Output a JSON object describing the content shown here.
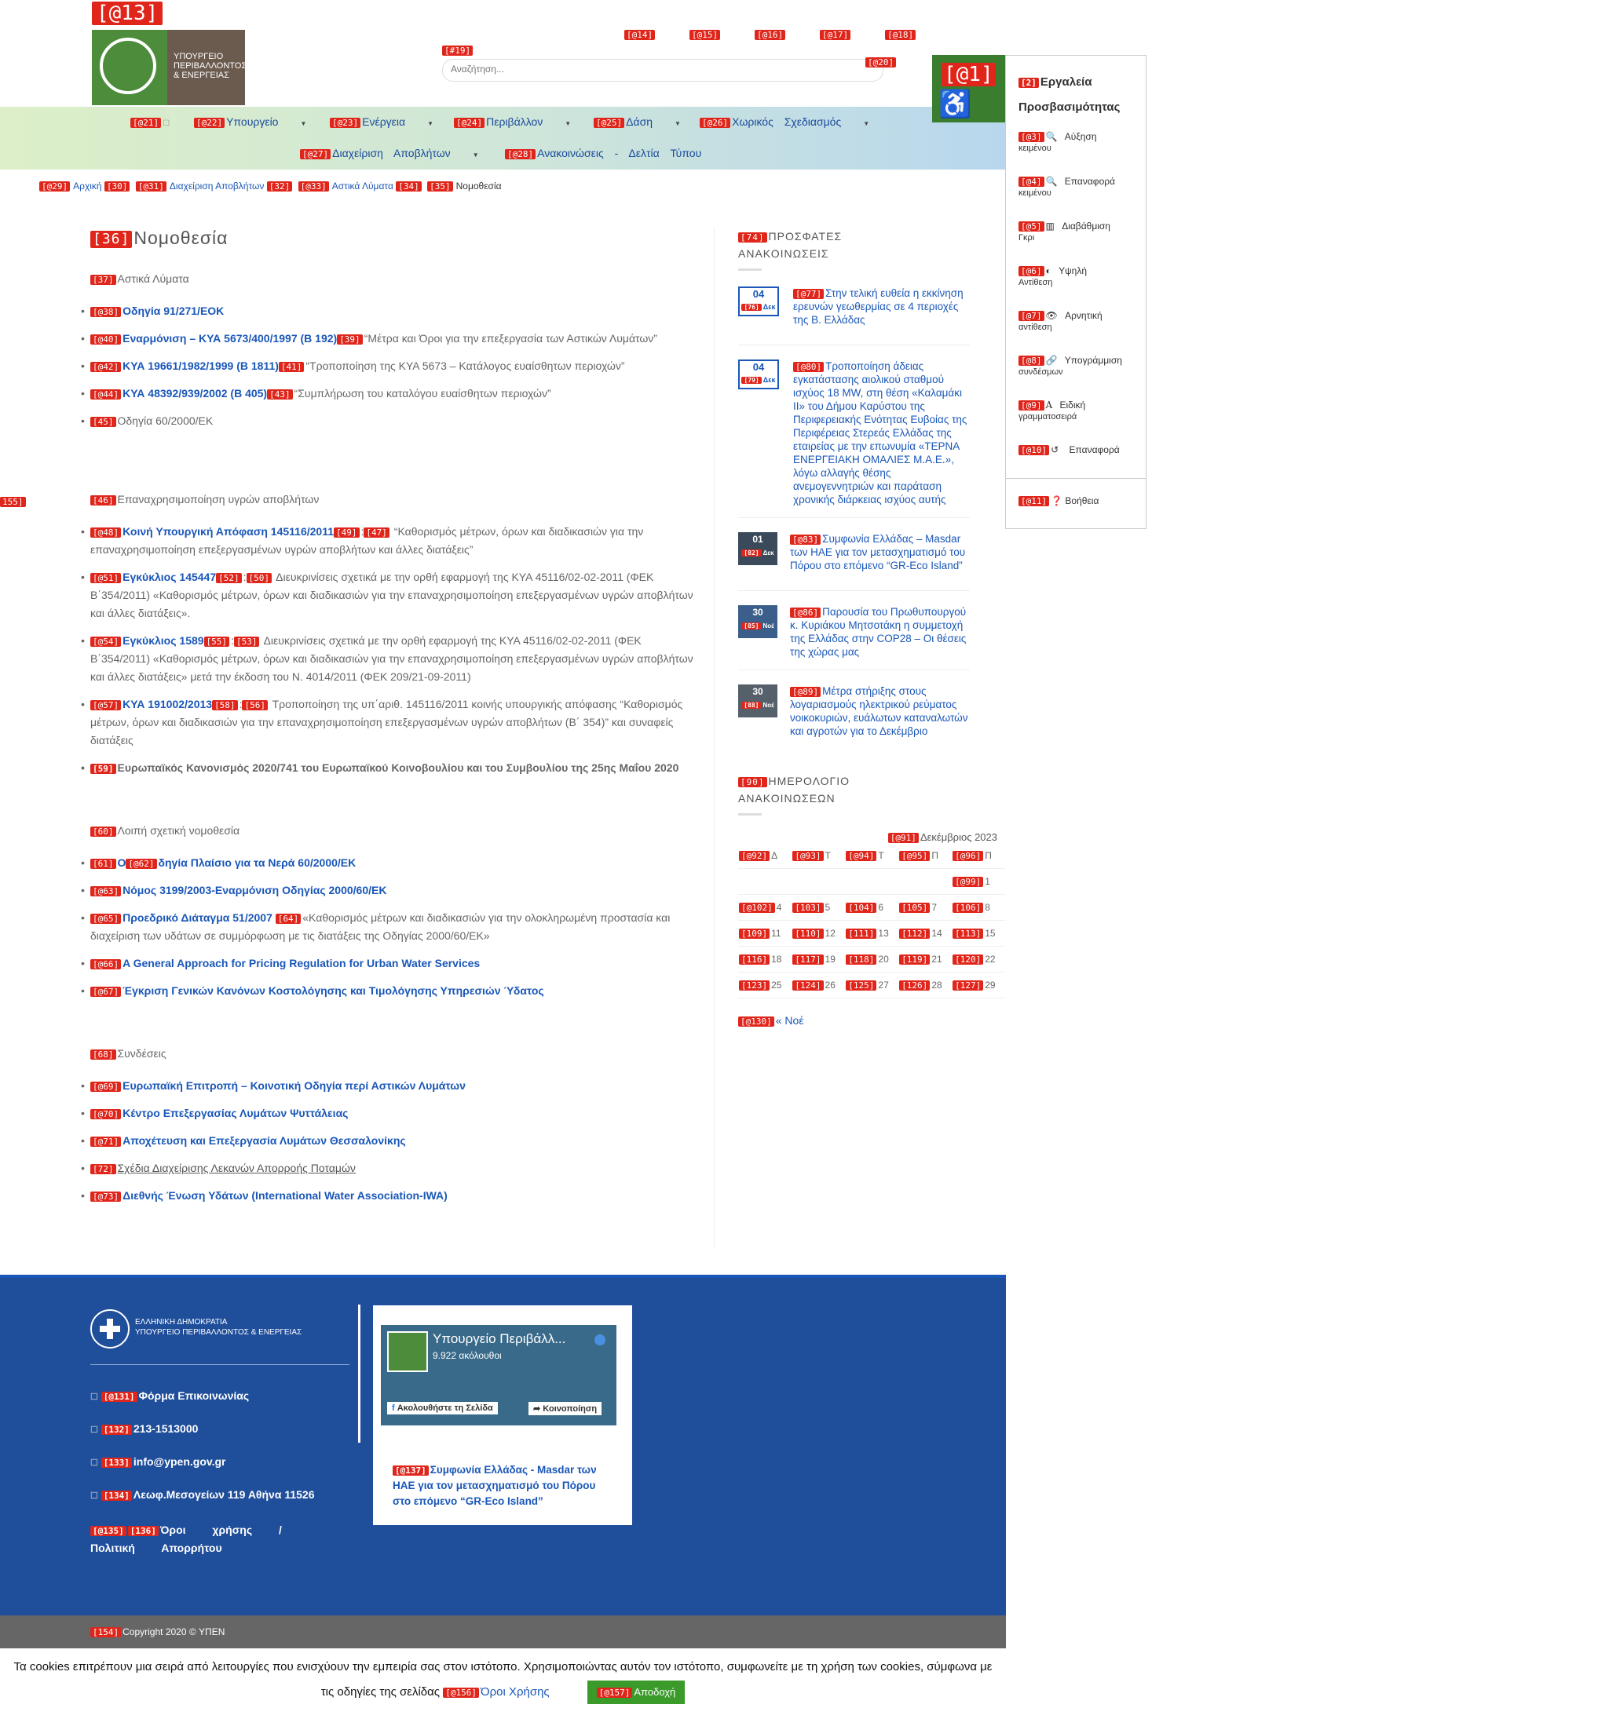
{
  "header": {
    "logo_tag": "[@13]",
    "logo_text_1": "ΥΠΟΥΡΓΕΙΟ",
    "logo_text_2": "ΠΕΡΙΒΑΛΛΟΝΤΟΣ",
    "logo_text_3": "& ΕΝΕΡΓΕΙΑΣ",
    "toplinks": [
      "[@14]",
      "[@15]",
      "[@16]",
      "[@17]",
      "[@18]"
    ],
    "search_tag": "[#19]",
    "search_placeholder": "Αναζήτηση...",
    "search_btn_tag": "[@20]"
  },
  "nav": [
    {
      "tag": "[@21]",
      "label": ""
    },
    {
      "tag": "[@22]",
      "label": "Υπουργείο"
    },
    {
      "tag": "[@23]",
      "label": "Ενέργεια"
    },
    {
      "tag": "[@24]",
      "label": "Περιβάλλον"
    },
    {
      "tag": "[@25]",
      "label": "Δάση"
    },
    {
      "tag": "[@26]",
      "label": "Χωρικός Σχεδιασμός"
    },
    {
      "tag": "[@27]",
      "label": "Διαχείριση Αποβλήτων"
    },
    {
      "tag": "[@28]",
      "label": "Ανακοινώσεις - Δελτία Τύπου"
    }
  ],
  "breadcrumb": {
    "t29": "[@29]",
    "home": "Αρχική",
    "t30": "[30]",
    "t31": "[@31]",
    "waste": "Διαχείριση Αποβλήτων",
    "t32": "[32]",
    "t33": "[@33]",
    "urban": "Αστικά Λύματα",
    "t34": "[34]",
    "t35": "[35]",
    "current": "Νομοθεσία"
  },
  "main": {
    "title_tag": "[36]",
    "title": "Νομοθεσία",
    "s1": {
      "tag": "[37]",
      "label": "Αστικά Λύματα"
    },
    "s1_items": [
      {
        "tag": "[@38]",
        "link": "Οδηγία 91/271/ΕΟΚ",
        "tag2": "",
        "text": ""
      },
      {
        "tag": "[@40]",
        "link": "Εναρμόνιση – ΚΥΑ 5673/400/1997 (Β 192)",
        "tag2": "[39]",
        "text": "“Μέτρα και Όροι για την επεξεργασία των Αστικών Λυμάτων”"
      },
      {
        "tag": "[@42]",
        "link": "ΚΥΑ 19661/1982/1999 (Β 1811)",
        "tag2": "[41]",
        "text": "“Τροποποίηση της ΚΥΑ 5673 – Κατάλογος ευαίσθητων περιοχών”"
      },
      {
        "tag": "[@44]",
        "link": "ΚΥΑ 48392/939/2002 (Β 405)",
        "tag2": "[43]",
        "text": "“Συμπλήρωση του καταλόγου ευαίσθητων περιοχών”"
      },
      {
        "tag": "[45]",
        "link": "",
        "tag2": "",
        "text": "Οδηγία 60/2000/ΕΚ"
      }
    ],
    "s2": {
      "tag": "[46]",
      "label": "Επαναχρησιμοποίηση υγρών αποβλήτων"
    },
    "s2_items": [
      {
        "tag": "[@48]",
        "link": "Κοινή Υπουργική Απόφαση 145116/2011",
        "tag2": "[49]",
        "tag3": "[47]",
        "text": "“Καθορισμός μέτρων, όρων και διαδικασιών για την επαναχρησιμοποίηση επεξεργασμένων υγρών αποβλήτων και άλλες διατάξεις”"
      },
      {
        "tag": "[@51]",
        "link": "Εγκύκλιος 145447",
        "tag2": "[52]",
        "tag3": "[50]",
        "text": "Διευκρινίσεις σχετικά με την ορθή εφαρμογή της ΚΥΑ 45116/02-02-2011 (ΦΕΚ Β΄354/2011) «Καθορισμός μέτρων, όρων και διαδικασιών για την επαναχρησιμοποίηση επεξεργασμένων υγρών αποβλήτων και άλλες διατάξεις»."
      },
      {
        "tag": "[@54]",
        "link": "Εγκύκλιος 1589",
        "tag2": "[55]",
        "tag3": "[53]",
        "text": "Διευκρινίσεις σχετικά με την ορθή εφαρμογή της ΚΥΑ 45116/02-02-2011 (ΦΕΚ Β΄354/2011) «Καθορισμός μέτρων, όρων και διαδικασιών για την επαναχρησιμοποίηση επεξεργασμένων υγρών αποβλήτων και άλλες διατάξεις» μετά την έκδοση του Ν. 4014/2011 (ΦΕΚ 209/21-09-2011)"
      },
      {
        "tag": "[@57]",
        "link": "ΚΥΑ 191002/2013",
        "tag2": "[58]",
        "tag3": "[56]",
        "text": "Τροποποίηση της υπ΄αριθ. 145116/2011 κοινής υπουργικής απόφασης “Καθορισμός μέτρων, όρων και διαδικασιών για την επαναχρησιμοποίηση επεξεργασμένων υγρών αποβλήτων (Β΄ 354)” και συναφείς διατάξεις"
      },
      {
        "tag": "[59]",
        "link": "",
        "tag2": "",
        "tag3": "",
        "text": "Ευρωπαϊκός Κανονισμός 2020/741 του Ευρωπαϊκού Κοινοβουλίου και του Συμβουλίου της 25ης Μαΐου 2020"
      }
    ],
    "s3": {
      "tag": "[60]",
      "label": "Λοιπή σχετική νομοθεσία"
    },
    "s3_items": [
      {
        "tag": "[61]",
        "link": "Ο",
        "tag2": "[@62]",
        "link2": "δηγία Πλαίσιο για τα Νερά 60/2000/ΕΚ",
        "text": ""
      },
      {
        "tag": "[@63]",
        "link": "Νόμος 3199/2003-Εναρμόνιση Οδηγίας 2000/60/ΕΚ",
        "tag2": "",
        "link2": "",
        "text": ""
      },
      {
        "tag": "[@65]",
        "link": "Προεδρικό Διάταγμα 51/2007",
        "tag2": "[64]",
        "link2": "",
        "text": "«Καθορισμός μέτρων και διαδικασιών για την ολοκληρωμένη προστασία και διαχείριση των υδάτων σε συμμόρφωση με τις διατάξεις της Οδηγίας 2000/60/ΕΚ»"
      },
      {
        "tag": "[@66]",
        "link": "A General Approach for Pricing Regulation for Urban Water Services",
        "tag2": "",
        "link2": "",
        "text": ""
      },
      {
        "tag": "[@67]",
        "link": "Έγκριση Γενικών Κανόνων Κοστολόγησης και Τιμολόγησης Υπηρεσιών Ύδατος",
        "tag2": "",
        "link2": "",
        "text": ""
      }
    ],
    "s4": {
      "tag": "[68]",
      "label": "Συνδέσεις"
    },
    "s4_items": [
      {
        "tag": "[@69]",
        "link": "Ευρωπαϊκή Επιτροπή – Κοινοτική Οδηγία περί Αστικών Λυμάτων"
      },
      {
        "tag": "[@70]",
        "link": "Κέντρο Επεξεργασίας Λυμάτων Ψυττάλειας"
      },
      {
        "tag": "[@71]",
        "link": "Αποχέτευση και Επεξεργασία Λυμάτων Θεσσαλονίκης"
      },
      {
        "tag": "[72]",
        "link": "Σχέδια Διαχείρισης Λεκανών Απορροής Ποταμών"
      },
      {
        "tag": "[@73]",
        "link": "Διεθνής Ένωση Υδάτων (International Water Association-IWA)"
      }
    ],
    "left_edge_tag": "155]"
  },
  "sidebar": {
    "recent_tag": "[74]",
    "recent_title_1": "ΠΡΟΣΦΑΤΕΣ",
    "recent_title_2": "ΑΝΑΚΟΙΝΩΣΕΙΣ",
    "news": [
      {
        "day": "04",
        "dtag": "[76]",
        "mon": "Δεκ",
        "tag": "[@77]",
        "text": "Στην τελική ευθεία η εκκίνηση ερευνών γεωθερμίας σε 4 περιοχές της Β. Ελλάδας",
        "thumb": false
      },
      {
        "day": "04",
        "dtag": "[79]",
        "mon": "Δεκ",
        "tag": "[@80]",
        "text": "Τροποποίηση άδειας εγκατάστασης αιολικού σταθμού ισχύος 18 MW, στη θέση «Καλαμάκι ΙΙ» του Δήμου Καρύστου της Περιφερειακής Ενότητας Ευβοίας της Περιφέρειας Στερεάς Ελλάδας της εταιρείας με την επωνυμία «ΤΕΡΝΑ ΕΝΕΡΓΕΙΑΚΗ ΟΜΑΛΙΕΣ Μ.Α.Ε.», λόγω αλλαγής θέσης ανεμογεννητριών και παράταση χρονικής διάρκειας ισχύος αυτής",
        "thumb": false
      },
      {
        "day": "01",
        "dtag": "[82]",
        "mon": "Δεκ",
        "tag": "[@83]",
        "text": "Συμφωνία Ελλάδας – Masdar των ΗΑΕ για τον μετασχηματισμό του Πόρου στο επόμενο “GR-Eco Island”",
        "thumb": true
      },
      {
        "day": "30",
        "dtag": "[85]",
        "mon": "Νοέ",
        "tag": "[@86]",
        "text": "Παρουσία του Πρωθυπουργού κ. Κυριάκου Μητσοτάκη η συμμετοχή της Ελλάδας στην COP28 – Οι θέσεις της χώρας μας",
        "thumb": true
      },
      {
        "day": "30",
        "dtag": "[88]",
        "mon": "Νοέ",
        "tag": "[@89]",
        "text": "Μέτρα στήριξης στους λογαριασμούς ηλεκτρικού ρεύματος νοικοκυριών, ευάλωτων καταναλωτών και αγροτών για το Δεκέμβριο",
        "thumb": true
      }
    ],
    "cal_tag": "[90]",
    "cal_title_1": "ΗΜΕΡΟΛΟΓΙΟ",
    "cal_title_2": "ΑΝΑΚΟΙΝΩΣΕΩΝ",
    "cal_month_tag": "[@91]",
    "cal_month": "Δεκέμβριος 2023",
    "cal_head": [
      [
        "[@92]",
        "Δ"
      ],
      [
        "[@93]",
        "Τ"
      ],
      [
        "[@94]",
        "Τ"
      ],
      [
        "[@95]",
        "Π"
      ],
      [
        "[@96]",
        "Π"
      ]
    ],
    "cal_rows": [
      [
        [
          "",
          ""
        ],
        [
          "",
          ""
        ],
        [
          "",
          ""
        ],
        [
          "",
          ""
        ],
        [
          "[@99]",
          "1"
        ]
      ],
      [
        [
          "[@102]",
          "4"
        ],
        [
          "[103]",
          "5"
        ],
        [
          "[104]",
          "6"
        ],
        [
          "[105]",
          "7"
        ],
        [
          "[106]",
          "8"
        ]
      ],
      [
        [
          "[109]",
          "11"
        ],
        [
          "[110]",
          "12"
        ],
        [
          "[111]",
          "13"
        ],
        [
          "[112]",
          "14"
        ],
        [
          "[113]",
          "15"
        ]
      ],
      [
        [
          "[116]",
          "18"
        ],
        [
          "[117]",
          "19"
        ],
        [
          "[118]",
          "20"
        ],
        [
          "[119]",
          "21"
        ],
        [
          "[120]",
          "22"
        ]
      ],
      [
        [
          "[123]",
          "25"
        ],
        [
          "[124]",
          "26"
        ],
        [
          "[125]",
          "27"
        ],
        [
          "[126]",
          "28"
        ],
        [
          "[127]",
          "29"
        ]
      ]
    ],
    "prev_tag": "[@130]",
    "prev_label": "« Νοέ"
  },
  "accessibility": {
    "btn_tag": "[@1]",
    "title_tag": "[2]",
    "title_1": "Εργαλεία",
    "title_2": "Προσβασιμότητας",
    "items": [
      {
        "tag": "[@3]",
        "icon": "🔍",
        "l1": "Αύξηση",
        "l2": "κειμένου"
      },
      {
        "tag": "[@4]",
        "icon": "🔍",
        "l1": "Επαναφορά",
        "l2": "κειμένου"
      },
      {
        "tag": "[@5]",
        "icon": "▥",
        "l1": "Διαβάθμιση",
        "l2": "Γκρι"
      },
      {
        "tag": "[@6]",
        "icon": "◐",
        "l1": "Υψηλή",
        "l2": "Αντίθεση"
      },
      {
        "tag": "[@7]",
        "icon": "👁",
        "l1": "Αρνητική",
        "l2": "αντίθεση"
      },
      {
        "tag": "[@8]",
        "icon": "🔗",
        "l1": "Υπογράμμιση",
        "l2": "συνδέσμων"
      },
      {
        "tag": "[@9]",
        "icon": "A",
        "l1": "Ειδική",
        "l2": "γραμματοσειρά"
      },
      {
        "tag": "[@10]",
        "icon": "↺",
        "l1": "Επαναφορά",
        "l2": ""
      }
    ],
    "help_tag": "[@11]",
    "help_label": "Βοήθεια"
  },
  "footer": {
    "gov_1": "ΕΛΛΗΝΙΚΗ ΔΗΜΟΚΡΑΤΙΑ",
    "gov_2": "ΥΠΟΥΡΓΕΙΟ ΠΕΡΙΒΑΛΛΟΝΤΟΣ & ΕΝΕΡΓΕΙΑΣ",
    "contact_tag": "[@131]",
    "contact": "Φόρμα Επικοινωνίας",
    "phone_tag": "[132]",
    "phone": "213-1513000",
    "email_tag": "[133]",
    "email": "info@ypen.gov.gr",
    "addr_tag": "[134]",
    "addr": "Λεωφ.Μεσογείων 119 Αθήνα 11526",
    "terms_tag": "[@135]",
    "terms_tag2": "[136]",
    "terms": "Όροι χρήσης / Πολιτική Απορρήτου",
    "fb_name": "Υπουργείο Περιβάλλ...",
    "fb_followers": "9.922 ακόλουθοι",
    "fb_follow": "Ακολουθήστε τη Σελίδα",
    "fb_share": "Κοινοποίηση",
    "fb_news_tag": "[@137]",
    "fb_news": "Συμφωνία Ελλάδας - Masdar των ΗΑΕ για τον μετασχηματισμό του Πόρου στο επόμενο “GR-Eco Island”",
    "copy_tag": "[154]",
    "copy": "Copyright 2020 © ΥΠΕΝ"
  },
  "cookie": {
    "text_1": "Τα cookies επιτρέπουν μια σειρά από λειτουργίες που ενισχύουν την εμπειρία σας στον ιστότοπο. Χρησιμοποιώντας αυτόν τον ιστότοπο, συμφωνείτε με τη χρήση των cookies, σύμφωνα με",
    "text_2": "τις οδηγίες της σελίδας",
    "terms_tag": "[@156]",
    "terms": "Όροι Χρήσης",
    "accept_tag": "[@157]",
    "accept": "Αποδοχή"
  },
  "colors": {
    "nav_text": "#1a4a9a",
    "link": "#1a57b8",
    "footer_bg": "#1f4e9b",
    "accent_green": "#3b7d2f",
    "tag_red": "#e0251b"
  }
}
